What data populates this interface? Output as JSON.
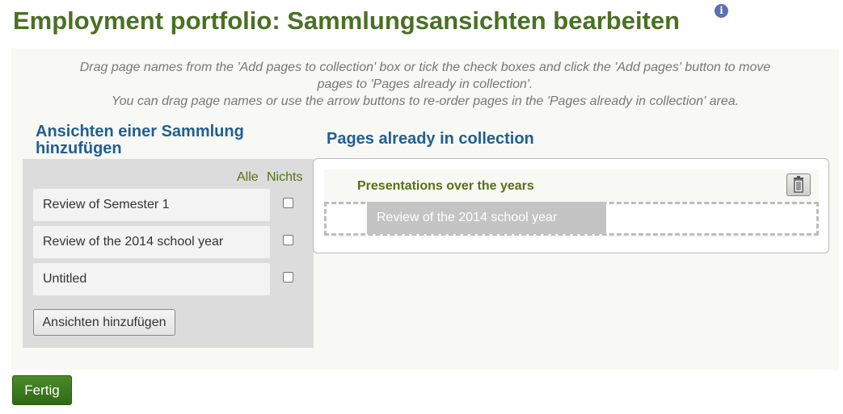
{
  "page": {
    "title": "Employment portfolio: Sammlungsansichten bearbeiten",
    "info_icon": "info-icon"
  },
  "instructions": {
    "line1": "Drag page names from the 'Add pages to collection' box or tick the check boxes and click the 'Add pages' button to move",
    "line2": "pages to 'Pages already in collection'.",
    "line3": "You can drag page names or use the arrow buttons to re-order pages in the 'Pages already in collection' area."
  },
  "add_pages": {
    "heading": "Ansichten einer Sammlung hinzufügen",
    "select_all": "Alle",
    "select_none": "Nichts",
    "items": [
      {
        "label": "Review of Semester 1",
        "checked": false
      },
      {
        "label": "Review of the 2014 school year",
        "checked": false
      },
      {
        "label": "Untitled",
        "checked": false
      }
    ],
    "add_button": "Ansichten hinzufügen"
  },
  "collection": {
    "heading": "Pages already in collection",
    "name": "Presentations over the years",
    "delete_icon": "trash-icon",
    "pages": [
      {
        "label": "Review of the 2014 school year"
      }
    ]
  },
  "footer": {
    "done_button": "Fertig"
  },
  "colors": {
    "title_green": "#4a7023",
    "heading_blue": "#1f5f94",
    "link_green": "#557014",
    "button_green": "#3a7a1c"
  }
}
